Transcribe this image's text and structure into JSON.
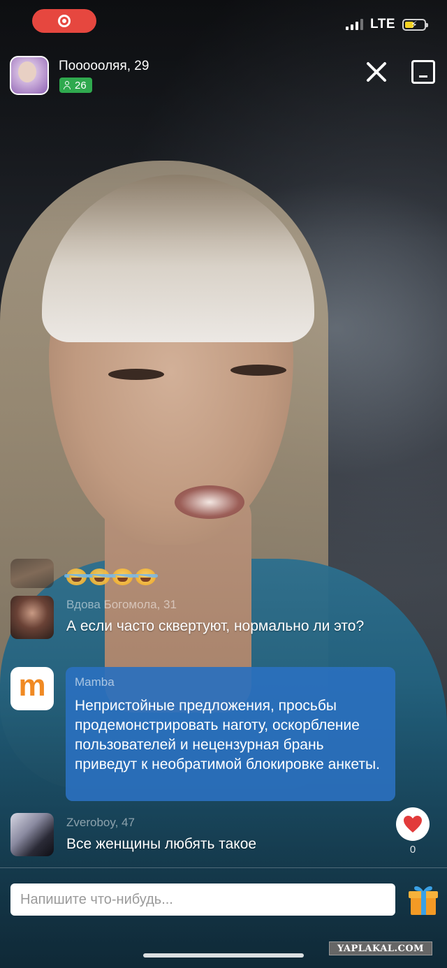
{
  "status_bar": {
    "network": "LTE",
    "battery_color": "#f5d222",
    "recording_color": "#e6473f"
  },
  "header": {
    "streamer_name": "Поооооляя, 29",
    "viewer_count": "26",
    "icons": [
      "person-icon",
      "close-icon",
      "minimize-icon"
    ]
  },
  "chat": {
    "messages": [
      {
        "author": "",
        "text": "😂😂😂😂",
        "faded": true
      },
      {
        "author": "Вдова Богомола, 31",
        "text": "А если часто сквертуют, нормально ли это?"
      },
      {
        "author": "Zveroboy, 47",
        "text": "Все женщины любять такое"
      }
    ],
    "system_message": {
      "author": "Mamba",
      "logo_letter": "m",
      "text": "Непристойные предложения, просьбы продемонстрировать наготу, оскорбление пользователей и нецензурная брань приведут к необратимой блокировке анкеты.",
      "bg_color": "#2a70be"
    }
  },
  "like": {
    "count": "0",
    "color": "#e23b3b"
  },
  "composer": {
    "placeholder": "Напишите что-нибудь..."
  },
  "watermark": "YAPLAKAL.COM"
}
